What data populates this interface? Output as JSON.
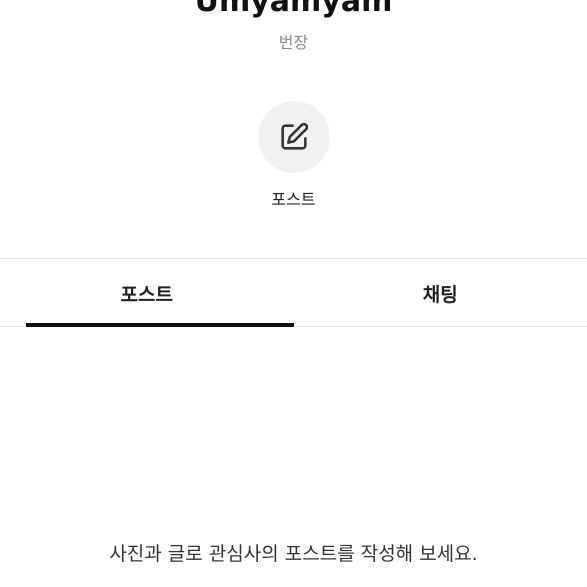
{
  "profile": {
    "name": "Umyamyam",
    "subtitle": "번장"
  },
  "action": {
    "icon": "edit-icon",
    "label": "포스트"
  },
  "tabs": [
    {
      "label": "포스트",
      "active": true
    },
    {
      "label": "채팅",
      "active": false
    }
  ],
  "empty_state": {
    "message": "사진과 글로 관심사의 포스트를 작성해 보세요."
  },
  "colors": {
    "text": "#111111",
    "muted": "#8a8a8a",
    "icon_bg": "#f2f2f2",
    "divider": "#e6e6e6",
    "indicator": "#111111"
  }
}
